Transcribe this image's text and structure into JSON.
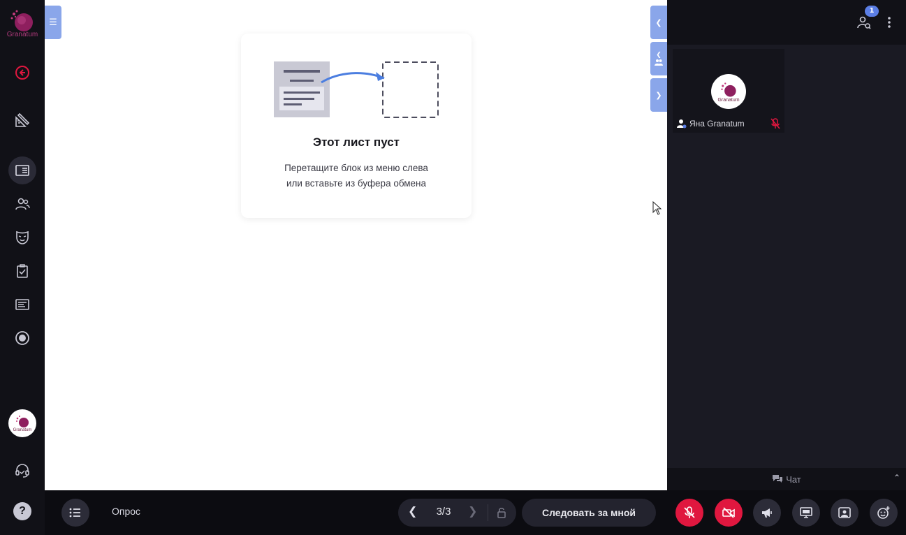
{
  "app": {
    "logo_text": "Granatum"
  },
  "colors": {
    "accent": "#8aa6ea",
    "danger": "#e0173f",
    "brand": "#b03a7c"
  },
  "sidebar": {
    "items": [
      {
        "name": "back",
        "icon": "arrow-left-circle-icon"
      },
      {
        "name": "tools",
        "icon": "ruler-pencil-icon"
      },
      {
        "name": "board",
        "icon": "board-list-icon",
        "active": true
      },
      {
        "name": "participants",
        "icon": "users-icon"
      },
      {
        "name": "mask",
        "icon": "mask-icon"
      },
      {
        "name": "tasks",
        "icon": "clipboard-check-icon"
      },
      {
        "name": "content",
        "icon": "text-block-icon"
      },
      {
        "name": "record",
        "icon": "record-icon"
      }
    ],
    "avatar_text": "Granatum",
    "support_icon": "headset-icon",
    "help_label": "?"
  },
  "canvas": {
    "empty_title": "Этот лист пуст",
    "empty_desc_line1": "Перетащите блок из меню слева",
    "empty_desc_line2": "или вставьте из буфера обмена"
  },
  "participants": {
    "count": "1",
    "tiles": [
      {
        "name": "Яна Granatum",
        "avatar_text": "Granatum",
        "muted": true
      }
    ]
  },
  "chat": {
    "label": "Чат"
  },
  "bottom": {
    "poll_label": "Опрос",
    "page_indicator": "3/3",
    "follow_label": "Следовать за мной"
  }
}
